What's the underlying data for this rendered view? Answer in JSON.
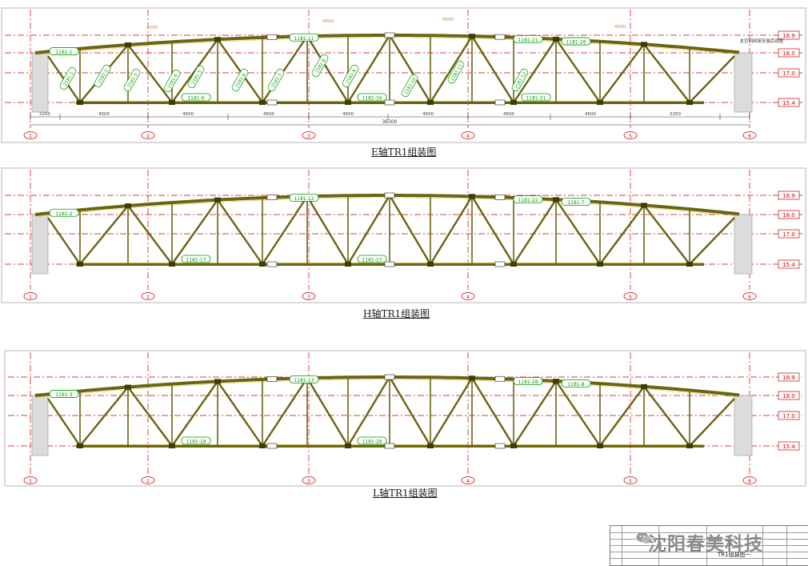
{
  "drawings": [
    {
      "caption": "E轴TR1组装图",
      "chord_tags": [
        "1181-1",
        "1181-11",
        "1181-21",
        "1181-26",
        "1181-6",
        "1181-16",
        "1181-21"
      ],
      "web_tags": [
        "2181-1",
        "2181-2",
        "2181-3",
        "2181-4",
        "2181-5",
        "2181-6",
        "2181-7",
        "2181-8",
        "2181-9",
        "2181-10",
        "2181-11",
        "2181-12"
      ],
      "dims_bottom": [
        "2250",
        "4500",
        "4500",
        "4500",
        "4500",
        "4500",
        "4500",
        "4500",
        "2250"
      ],
      "dim_total": "36300",
      "note": "支空间网架安装后调整",
      "top_dims": [
        "4500",
        "4500",
        "4500",
        "4500"
      ]
    },
    {
      "caption": "H轴TR1组装图",
      "chord_tags": [
        "1181-2",
        "1181-12",
        "1181-22",
        "1181-7",
        "1181-17",
        "1181-27"
      ]
    },
    {
      "caption": "L轴TR1组装图",
      "chord_tags": [
        "1181-3",
        "1181-13",
        "1181-28",
        "1181-8",
        "1181-18",
        "1181-28"
      ]
    }
  ],
  "elevations": [
    "18.9",
    "18.0",
    "17.0",
    "15.4"
  ],
  "axis_labels": [
    "1",
    "2",
    "3",
    "4",
    "5",
    "6"
  ],
  "title_block": {
    "drawing_title": "TR1组装图一"
  },
  "watermark": "沈阳春美科技",
  "colors": {
    "truss": "#6b6410",
    "axis": "#cc0000",
    "tag": "#009900",
    "support": "#dcdcdc"
  }
}
